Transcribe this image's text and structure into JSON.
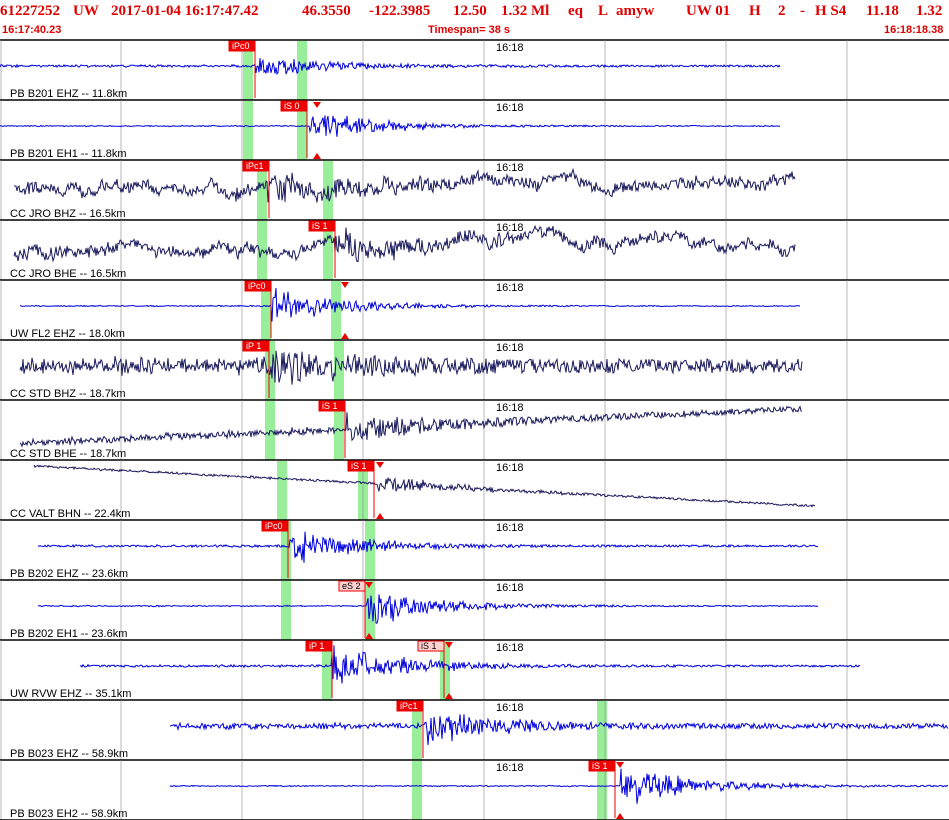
{
  "header": {
    "event_id": "61227252",
    "network": "UW",
    "origin_time": "2017-01-04 16:17:47.42",
    "lat": "46.3550",
    "lon": "-122.3985",
    "depth": "12.50",
    "mag": "1.32 Ml",
    "type": "eq",
    "flags": "L",
    "author": "amyw",
    "solution": "UW 01",
    "quality": "H",
    "count": "2",
    "dash": "-",
    "h_code": "H S4",
    "rms": "11.18",
    "mag2": "1.32"
  },
  "time_start": "16:17:40.23",
  "timespan_label": "Timespan=",
  "timespan_value": "38 s",
  "time_end": "16:18:18.38",
  "colors": {
    "header_red": "#e00000",
    "trace_blue": "#0000dd",
    "trace_navy": "#1a1a5e",
    "pick_red": "#ee0000",
    "pick_light": "#ffd0d0",
    "window_green": "#99ee99",
    "grid": "#000000"
  },
  "chart_data": {
    "type": "seismogram-panels",
    "time_axis": {
      "start": "16:17:40.23",
      "end": "16:18:18.38",
      "span_s": 38,
      "minute_tick": "16:18"
    },
    "traces": [
      {
        "label": "PB B201 EHZ -- 11.8km",
        "color": "blue",
        "picks": [
          {
            "label": "iPc0",
            "style": "dark",
            "marker": false
          }
        ]
      },
      {
        "label": "PB B201 EH1 -- 11.8km",
        "color": "blue",
        "picks": [
          {
            "label": "iS 0",
            "style": "dark",
            "marker": true
          }
        ]
      },
      {
        "label": "CC JRO BHZ -- 16.5km",
        "color": "navy",
        "picks": [
          {
            "label": "iPc1",
            "style": "dark",
            "marker": false
          }
        ]
      },
      {
        "label": "CC JRO BHE -- 16.5km",
        "color": "navy",
        "picks": [
          {
            "label": "iS 1",
            "style": "dark",
            "marker": false
          }
        ]
      },
      {
        "label": "UW FL2 EHZ -- 18.0km",
        "color": "blue",
        "picks": [
          {
            "label": "iPc0",
            "style": "dark",
            "marker": false
          },
          {
            "label": "",
            "style": "marker",
            "marker": true
          }
        ]
      },
      {
        "label": "CC STD BHZ -- 18.7km",
        "color": "navy",
        "picks": [
          {
            "label": "iP 1",
            "style": "dark",
            "marker": false
          }
        ]
      },
      {
        "label": "CC STD BHE -- 18.7km",
        "color": "navy",
        "picks": [
          {
            "label": "iS 1",
            "style": "dark",
            "marker": false
          }
        ]
      },
      {
        "label": "CC VALT BHN -- 22.4km",
        "color": "navy",
        "picks": [
          {
            "label": "iS 1",
            "style": "dark",
            "marker": true
          }
        ]
      },
      {
        "label": "PB B202 EHZ -- 23.6km",
        "color": "blue",
        "picks": [
          {
            "label": "iPc0",
            "style": "dark",
            "marker": false
          }
        ]
      },
      {
        "label": "PB B202 EH1 -- 23.6km",
        "color": "blue",
        "picks": [
          {
            "label": "eS 2",
            "style": "light",
            "marker": true
          }
        ]
      },
      {
        "label": "UW RVW EHZ -- 35.1km",
        "color": "blue",
        "picks": [
          {
            "label": "iP 1",
            "style": "dark",
            "marker": false
          },
          {
            "label": "iS 1",
            "style": "light",
            "marker": true
          }
        ]
      },
      {
        "label": "PB B023 EHZ -- 58.9km",
        "color": "blue",
        "picks": [
          {
            "label": "iPc1",
            "style": "dark",
            "marker": false
          }
        ]
      },
      {
        "label": "PB B023 EH2 -- 58.9km",
        "color": "blue",
        "picks": [
          {
            "label": "iS 1",
            "style": "dark",
            "marker": true
          }
        ]
      }
    ]
  }
}
